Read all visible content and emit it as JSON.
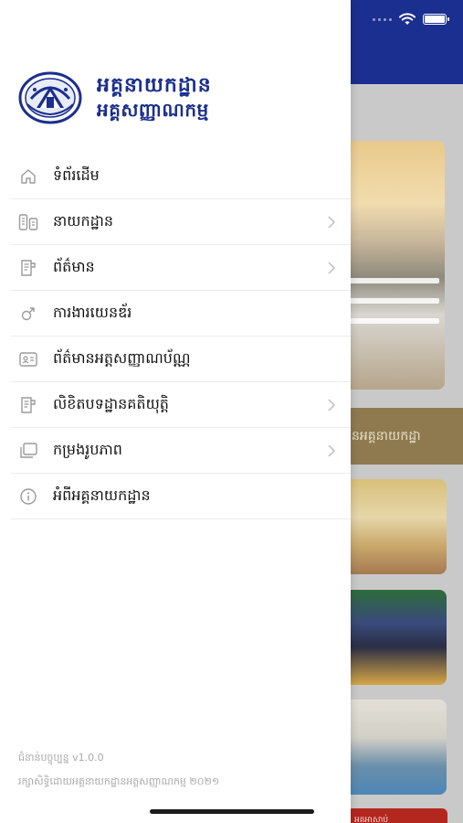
{
  "status_bar": {
    "wifi_icon": "wifi-icon",
    "battery_icon": "battery-icon",
    "battery_level": 0.9
  },
  "background": {
    "band_text": "នអគ្គនាយកដ្ឋា",
    "red_label": "អគអាសាប់"
  },
  "drawer": {
    "logo": {
      "line1": "អគ្គនាយកដ្ឋាន",
      "line2": "អគ្គសញ្ញាណកម្ម"
    },
    "menu": [
      {
        "label": "ទំព័រដើម",
        "icon": "home-icon",
        "has_chevron": false
      },
      {
        "label": "នាយកដ្ឋាន",
        "icon": "departments-icon",
        "has_chevron": true
      },
      {
        "label": "ព័ត៌មាន",
        "icon": "news-icon",
        "has_chevron": true
      },
      {
        "label": "ការងារយេនឌ័រ",
        "icon": "gender-icon",
        "has_chevron": false
      },
      {
        "label": "ព័ត៌មានអត្តសញ្ញាណប័ណ្ណ",
        "icon": "id-card-icon",
        "has_chevron": false
      },
      {
        "label": "លិខិតបទដ្ឋានគតិយុត្តិ",
        "icon": "legal-docs-icon",
        "has_chevron": true
      },
      {
        "label": "កម្រងរូបភាព",
        "icon": "gallery-icon",
        "has_chevron": true
      },
      {
        "label": "អំពីអគ្គនាយកដ្ឋាន",
        "icon": "info-icon",
        "has_chevron": false
      }
    ],
    "footer": {
      "version": "ជំនាន់បច្ចុប្បន្ន v1.0.0",
      "copyright": "រក្សាសិទ្ធិដោយអគ្គនាយកដ្ឋានអត្តសញ្ញាណកម្ម ២០២១"
    }
  },
  "colors": {
    "brand": "#1c2f8e",
    "header_bg": "#1a2f8f",
    "icon_gray": "#9a9a9a",
    "band_bg": "#8f7a50"
  }
}
